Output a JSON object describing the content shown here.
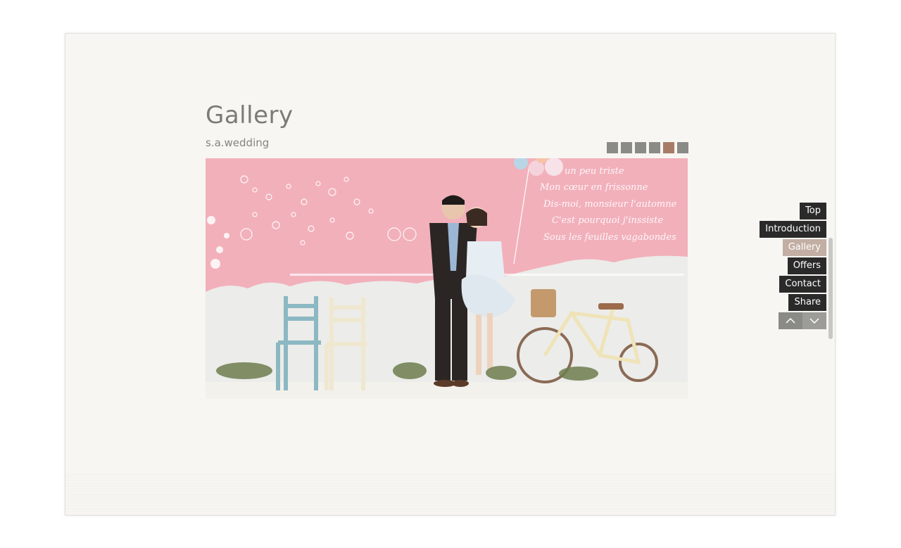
{
  "section": {
    "title": "Gallery",
    "subtitle": "s.a.wedding"
  },
  "gallery": {
    "slide_count": 6,
    "active_index": 4,
    "photo": {
      "wall_text": [
        "un peu triste",
        "Mon cœur en frissonne",
        "Dis-moi, monsieur l'automne",
        "C'est pourquoi j'inssiste",
        "Sous les feuilles vagabondes"
      ]
    }
  },
  "side_nav": {
    "items": [
      {
        "label": "Top",
        "active": false
      },
      {
        "label": "Introduction",
        "active": false
      },
      {
        "label": "Gallery",
        "active": true
      },
      {
        "label": "Offers",
        "active": false
      },
      {
        "label": "Contact",
        "active": false
      },
      {
        "label": "Share",
        "active": false
      }
    ],
    "prev_icon": "chevron-up-icon",
    "next_icon": "chevron-down-icon"
  },
  "colors": {
    "page_bg": "#f7f6f3",
    "nav_bg": "#2a2a2a",
    "nav_active": "#c3aea3",
    "dot": "#8a8a86",
    "dot_active": "#a87b68",
    "title": "#7b7b74"
  }
}
